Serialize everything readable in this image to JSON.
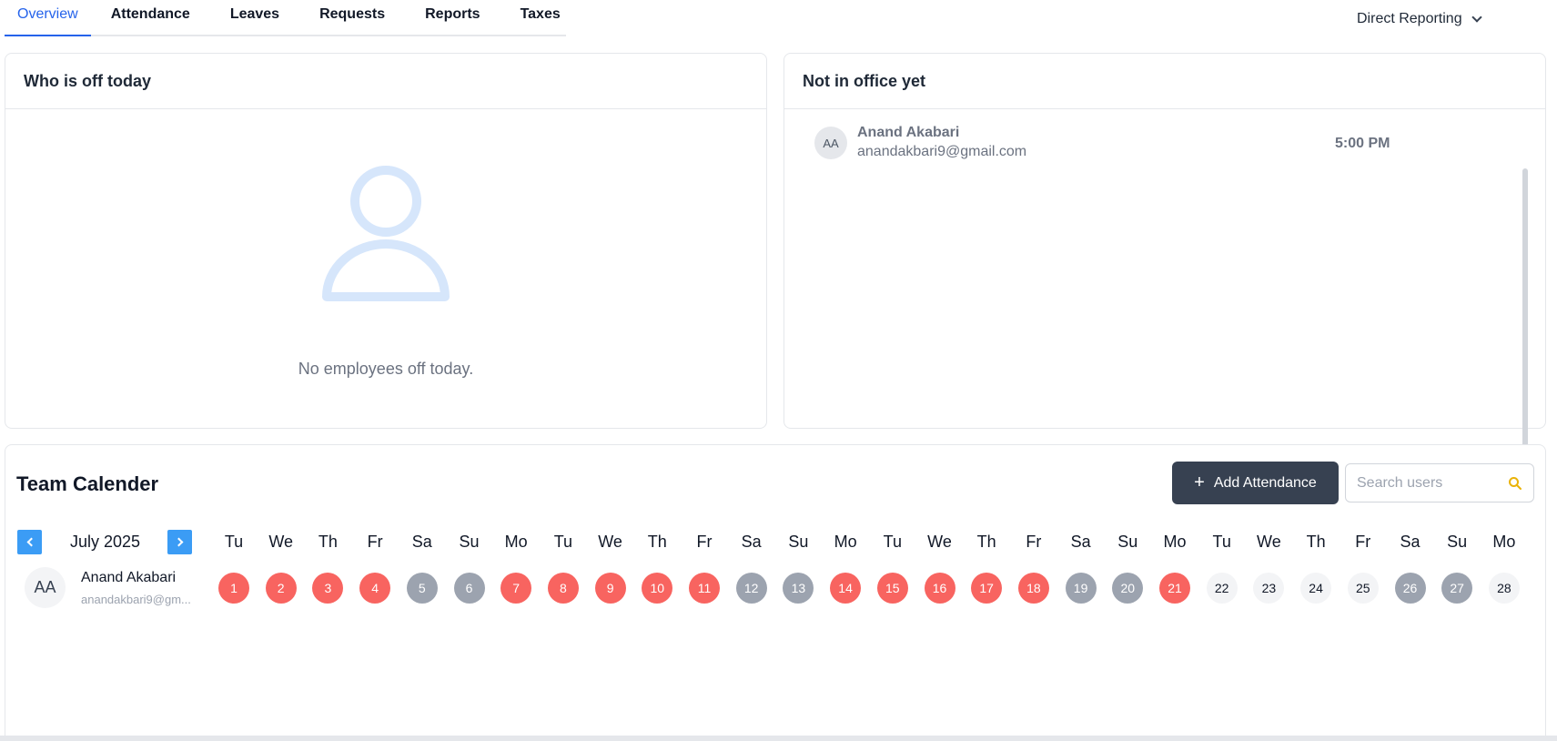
{
  "tabs": [
    {
      "label": "Overview",
      "active": true
    },
    {
      "label": "Attendance"
    },
    {
      "label": "Leaves"
    },
    {
      "label": "Requests"
    },
    {
      "label": "Reports"
    },
    {
      "label": "Taxes"
    }
  ],
  "filter": {
    "label": "Direct Reporting"
  },
  "off_today": {
    "title": "Who is off today",
    "empty_text": "No employees off today."
  },
  "not_in_office": {
    "title": "Not in office yet",
    "rows": [
      {
        "initials": "AA",
        "name": "Anand Akabari",
        "email": "anandakbari9@gmail.com",
        "time": "5:00 PM"
      }
    ]
  },
  "team_calendar": {
    "title": "Team Calender",
    "add_button": "Add Attendance",
    "search_placeholder": "Search users",
    "month": "July 2025",
    "weekdays": [
      "Tu",
      "We",
      "Th",
      "Fr",
      "Sa",
      "Su",
      "Mo",
      "Tu",
      "We",
      "Th",
      "Fr",
      "Sa",
      "Su",
      "Mo",
      "Tu",
      "We",
      "Th",
      "Fr",
      "Sa",
      "Su",
      "Mo",
      "Tu",
      "We",
      "Th",
      "Fr",
      "Sa",
      "Su",
      "Mo"
    ],
    "user": {
      "initials": "AA",
      "name": "Anand Akabari",
      "email": "anandakbari9@gm..."
    },
    "days": [
      {
        "d": "1",
        "status": "absent"
      },
      {
        "d": "2",
        "status": "absent"
      },
      {
        "d": "3",
        "status": "absent"
      },
      {
        "d": "4",
        "status": "absent"
      },
      {
        "d": "5",
        "status": "weekend"
      },
      {
        "d": "6",
        "status": "weekend"
      },
      {
        "d": "7",
        "status": "absent"
      },
      {
        "d": "8",
        "status": "absent"
      },
      {
        "d": "9",
        "status": "absent"
      },
      {
        "d": "10",
        "status": "absent"
      },
      {
        "d": "11",
        "status": "absent"
      },
      {
        "d": "12",
        "status": "weekend"
      },
      {
        "d": "13",
        "status": "weekend"
      },
      {
        "d": "14",
        "status": "absent"
      },
      {
        "d": "15",
        "status": "absent"
      },
      {
        "d": "16",
        "status": "absent"
      },
      {
        "d": "17",
        "status": "absent"
      },
      {
        "d": "18",
        "status": "absent"
      },
      {
        "d": "19",
        "status": "weekend"
      },
      {
        "d": "20",
        "status": "weekend"
      },
      {
        "d": "21",
        "status": "absent"
      },
      {
        "d": "22",
        "status": "future"
      },
      {
        "d": "23",
        "status": "future"
      },
      {
        "d": "24",
        "status": "future"
      },
      {
        "d": "25",
        "status": "future"
      },
      {
        "d": "26",
        "status": "weekend"
      },
      {
        "d": "27",
        "status": "weekend"
      },
      {
        "d": "28",
        "status": "future"
      }
    ]
  },
  "colors": {
    "accent": "#2563eb",
    "absent": "#f86460",
    "weekend": "#9ca3af",
    "nav": "#3b9cf5",
    "button": "#374151"
  },
  "icons": {
    "empty_state": "user-outline-icon",
    "dropdown": "chevron-down-icon",
    "search": "search-icon",
    "add": "plus-icon",
    "prev": "chevron-left-icon",
    "next": "chevron-right-icon"
  }
}
